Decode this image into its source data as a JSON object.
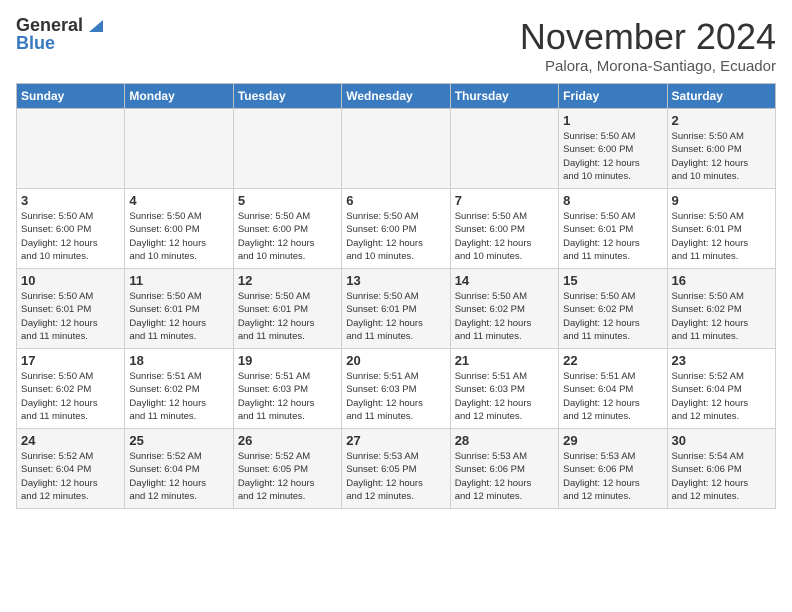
{
  "header": {
    "logo_line1": "General",
    "logo_line2": "Blue",
    "month": "November 2024",
    "location": "Palora, Morona-Santiago, Ecuador"
  },
  "days_of_week": [
    "Sunday",
    "Monday",
    "Tuesday",
    "Wednesday",
    "Thursday",
    "Friday",
    "Saturday"
  ],
  "weeks": [
    [
      {
        "day": "",
        "info": ""
      },
      {
        "day": "",
        "info": ""
      },
      {
        "day": "",
        "info": ""
      },
      {
        "day": "",
        "info": ""
      },
      {
        "day": "",
        "info": ""
      },
      {
        "day": "1",
        "info": "Sunrise: 5:50 AM\nSunset: 6:00 PM\nDaylight: 12 hours\nand 10 minutes."
      },
      {
        "day": "2",
        "info": "Sunrise: 5:50 AM\nSunset: 6:00 PM\nDaylight: 12 hours\nand 10 minutes."
      }
    ],
    [
      {
        "day": "3",
        "info": "Sunrise: 5:50 AM\nSunset: 6:00 PM\nDaylight: 12 hours\nand 10 minutes."
      },
      {
        "day": "4",
        "info": "Sunrise: 5:50 AM\nSunset: 6:00 PM\nDaylight: 12 hours\nand 10 minutes."
      },
      {
        "day": "5",
        "info": "Sunrise: 5:50 AM\nSunset: 6:00 PM\nDaylight: 12 hours\nand 10 minutes."
      },
      {
        "day": "6",
        "info": "Sunrise: 5:50 AM\nSunset: 6:00 PM\nDaylight: 12 hours\nand 10 minutes."
      },
      {
        "day": "7",
        "info": "Sunrise: 5:50 AM\nSunset: 6:00 PM\nDaylight: 12 hours\nand 10 minutes."
      },
      {
        "day": "8",
        "info": "Sunrise: 5:50 AM\nSunset: 6:01 PM\nDaylight: 12 hours\nand 11 minutes."
      },
      {
        "day": "9",
        "info": "Sunrise: 5:50 AM\nSunset: 6:01 PM\nDaylight: 12 hours\nand 11 minutes."
      }
    ],
    [
      {
        "day": "10",
        "info": "Sunrise: 5:50 AM\nSunset: 6:01 PM\nDaylight: 12 hours\nand 11 minutes."
      },
      {
        "day": "11",
        "info": "Sunrise: 5:50 AM\nSunset: 6:01 PM\nDaylight: 12 hours\nand 11 minutes."
      },
      {
        "day": "12",
        "info": "Sunrise: 5:50 AM\nSunset: 6:01 PM\nDaylight: 12 hours\nand 11 minutes."
      },
      {
        "day": "13",
        "info": "Sunrise: 5:50 AM\nSunset: 6:01 PM\nDaylight: 12 hours\nand 11 minutes."
      },
      {
        "day": "14",
        "info": "Sunrise: 5:50 AM\nSunset: 6:02 PM\nDaylight: 12 hours\nand 11 minutes."
      },
      {
        "day": "15",
        "info": "Sunrise: 5:50 AM\nSunset: 6:02 PM\nDaylight: 12 hours\nand 11 minutes."
      },
      {
        "day": "16",
        "info": "Sunrise: 5:50 AM\nSunset: 6:02 PM\nDaylight: 12 hours\nand 11 minutes."
      }
    ],
    [
      {
        "day": "17",
        "info": "Sunrise: 5:50 AM\nSunset: 6:02 PM\nDaylight: 12 hours\nand 11 minutes."
      },
      {
        "day": "18",
        "info": "Sunrise: 5:51 AM\nSunset: 6:02 PM\nDaylight: 12 hours\nand 11 minutes."
      },
      {
        "day": "19",
        "info": "Sunrise: 5:51 AM\nSunset: 6:03 PM\nDaylight: 12 hours\nand 11 minutes."
      },
      {
        "day": "20",
        "info": "Sunrise: 5:51 AM\nSunset: 6:03 PM\nDaylight: 12 hours\nand 11 minutes."
      },
      {
        "day": "21",
        "info": "Sunrise: 5:51 AM\nSunset: 6:03 PM\nDaylight: 12 hours\nand 12 minutes."
      },
      {
        "day": "22",
        "info": "Sunrise: 5:51 AM\nSunset: 6:04 PM\nDaylight: 12 hours\nand 12 minutes."
      },
      {
        "day": "23",
        "info": "Sunrise: 5:52 AM\nSunset: 6:04 PM\nDaylight: 12 hours\nand 12 minutes."
      }
    ],
    [
      {
        "day": "24",
        "info": "Sunrise: 5:52 AM\nSunset: 6:04 PM\nDaylight: 12 hours\nand 12 minutes."
      },
      {
        "day": "25",
        "info": "Sunrise: 5:52 AM\nSunset: 6:04 PM\nDaylight: 12 hours\nand 12 minutes."
      },
      {
        "day": "26",
        "info": "Sunrise: 5:52 AM\nSunset: 6:05 PM\nDaylight: 12 hours\nand 12 minutes."
      },
      {
        "day": "27",
        "info": "Sunrise: 5:53 AM\nSunset: 6:05 PM\nDaylight: 12 hours\nand 12 minutes."
      },
      {
        "day": "28",
        "info": "Sunrise: 5:53 AM\nSunset: 6:06 PM\nDaylight: 12 hours\nand 12 minutes."
      },
      {
        "day": "29",
        "info": "Sunrise: 5:53 AM\nSunset: 6:06 PM\nDaylight: 12 hours\nand 12 minutes."
      },
      {
        "day": "30",
        "info": "Sunrise: 5:54 AM\nSunset: 6:06 PM\nDaylight: 12 hours\nand 12 minutes."
      }
    ]
  ]
}
